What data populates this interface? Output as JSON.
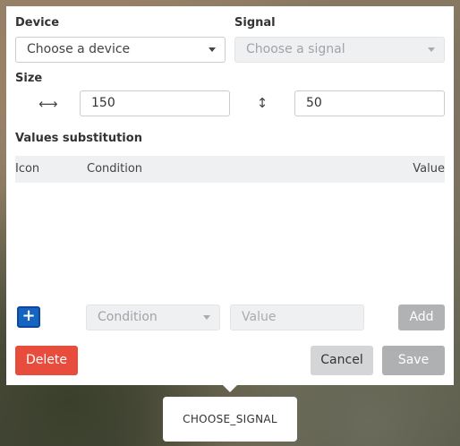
{
  "device": {
    "label": "Device",
    "placeholder": "Choose a device"
  },
  "signal": {
    "label": "Signal",
    "placeholder": "Choose a signal"
  },
  "size": {
    "label": "Size",
    "width_icon": "horizontal-resize-icon",
    "width_value": "150",
    "height_icon": "vertical-resize-icon",
    "height_value": "50"
  },
  "substitution": {
    "title": "Values substitution",
    "columns": {
      "icon": "Icon",
      "condition": "Condition",
      "value": "Value"
    },
    "new_row": {
      "add_icon_symbol": "+",
      "condition_placeholder": "Condition",
      "value_placeholder": "Value",
      "add_label": "Add"
    }
  },
  "footer": {
    "delete_label": "Delete",
    "cancel_label": "Cancel",
    "save_label": "Save"
  },
  "tooltip": {
    "text": "CHOOSE_SIGNAL"
  },
  "colors": {
    "primary": "#1565c0",
    "danger": "#e74c3c",
    "disabled": "#aeb0b2"
  }
}
